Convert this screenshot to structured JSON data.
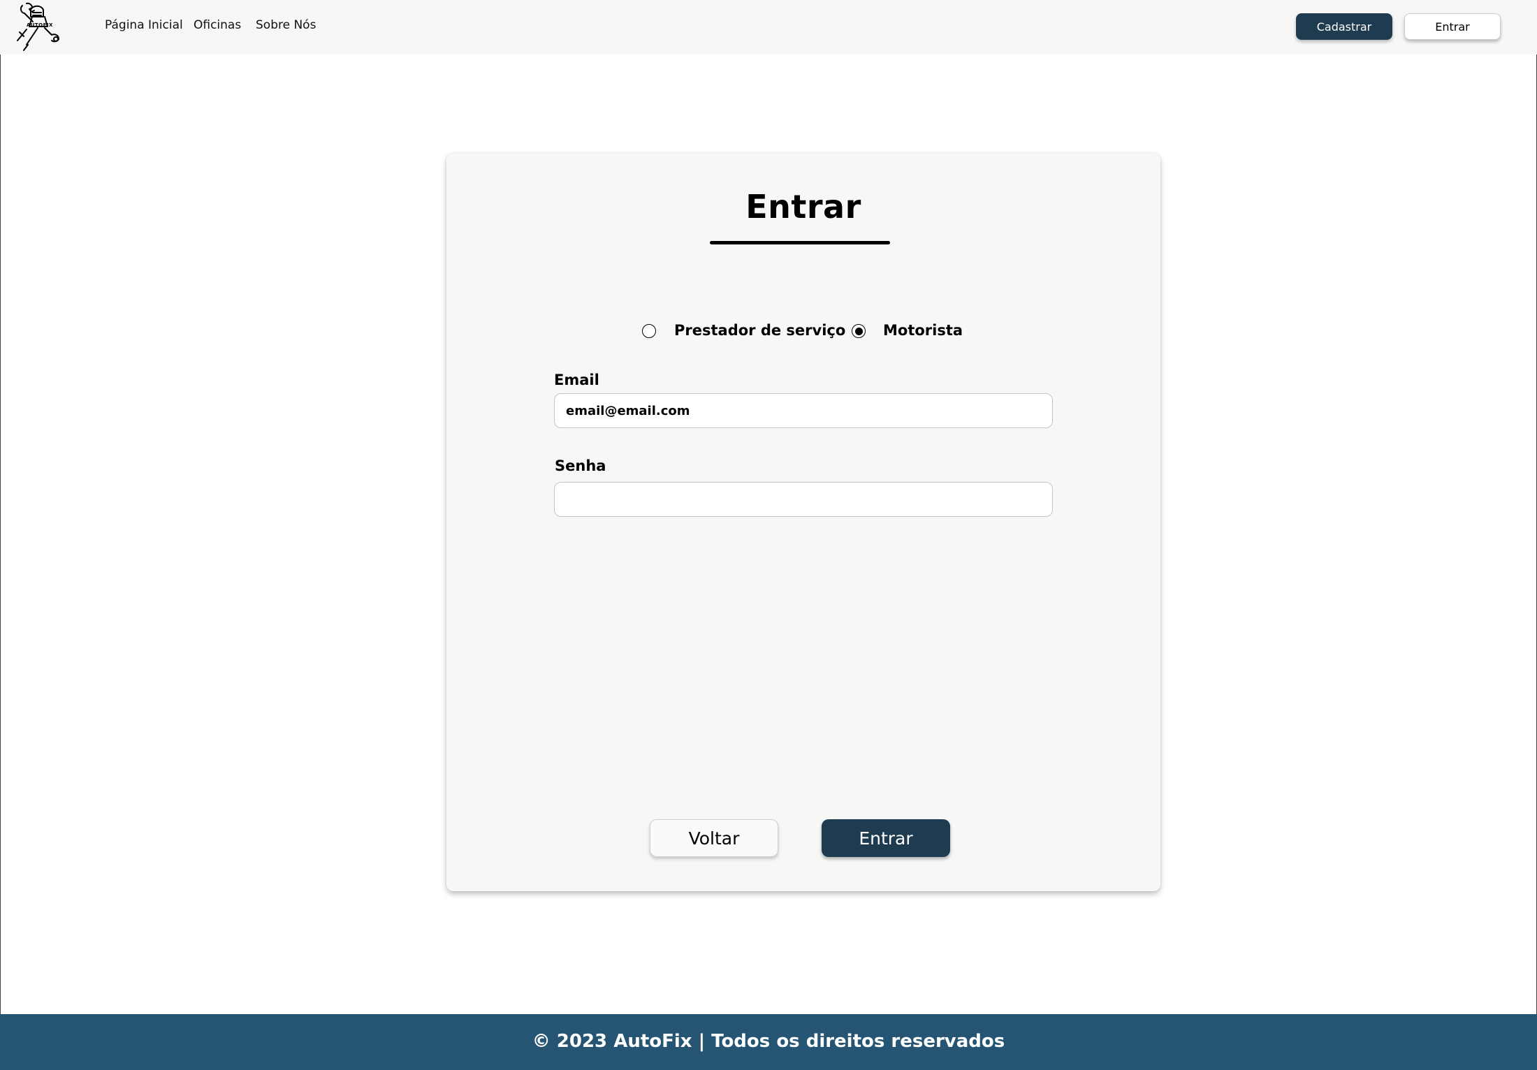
{
  "header": {
    "logo_icon": "mechanic-tools-logo-icon",
    "logo_text": "AUTOFIX",
    "nav": [
      {
        "label": "Página Inicial"
      },
      {
        "label": "Oficinas"
      },
      {
        "label": "Sobre Nós"
      }
    ],
    "register_label": "Cadastrar",
    "login_label": "Entrar"
  },
  "login_card": {
    "title": "Entrar",
    "user_types": [
      {
        "label": "Prestador de serviço",
        "checked": false
      },
      {
        "label": "Motorista",
        "checked": true
      }
    ],
    "email": {
      "label": "Email",
      "value": "email@email.com"
    },
    "password": {
      "label": "Senha",
      "value": ""
    },
    "back_label": "Voltar",
    "submit_label": "Entrar"
  },
  "footer": {
    "text": "© 2023 AutoFix | Todos os direitos reservados"
  },
  "colors": {
    "primary": "#1f3b50",
    "footer": "#255573",
    "header_bg": "#f7f7f7",
    "card_bg": "#f7f7f7"
  }
}
